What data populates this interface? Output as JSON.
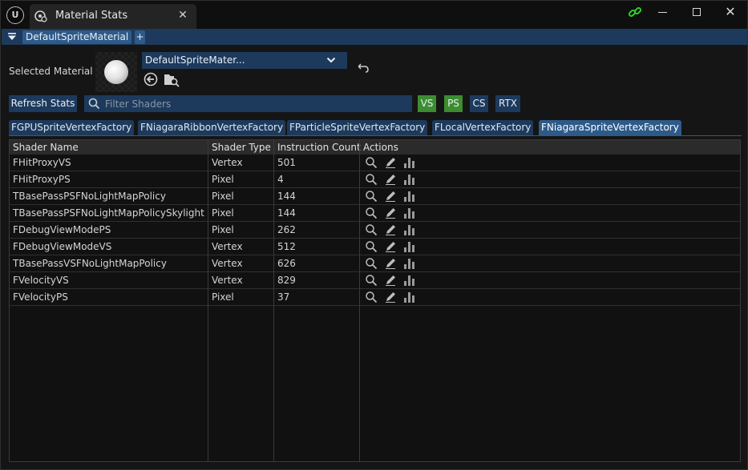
{
  "titlebar": {
    "logo_text": "U",
    "tab_title": "Material Stats",
    "close_glyph": "✕",
    "window_close_glyph": "✕"
  },
  "toolbar": {
    "material_chip": "DefaultSpriteMaterial",
    "add_label": "+"
  },
  "material": {
    "label": "Selected Material",
    "dropdown_value": "DefaultSpriteMater..."
  },
  "filter": {
    "refresh_label": "Refresh Stats",
    "search_placeholder": "Filter Shaders",
    "shader_buttons": [
      "VS",
      "PS",
      "CS",
      "RTX"
    ]
  },
  "vertex_factories": [
    "FGPUSpriteVertexFactory",
    "FNiagaraRibbonVertexFactory",
    "FParticleSpriteVertexFactory",
    "FLocalVertexFactory",
    "FNiagaraSpriteVertexFactory"
  ],
  "active_factory": "FNiagaraSpriteVertexFactory",
  "table": {
    "headers": [
      "Shader Name",
      "Shader Type",
      "Instruction Count",
      "Actions"
    ],
    "rows": [
      {
        "name": "FHitProxyVS",
        "type": "Vertex",
        "count": "501"
      },
      {
        "name": "FHitProxyPS",
        "type": "Pixel",
        "count": "4"
      },
      {
        "name": "TBasePassPSFNoLightMapPolicy",
        "type": "Pixel",
        "count": "144"
      },
      {
        "name": "TBasePassPSFNoLightMapPolicySkylight",
        "type": "Pixel",
        "count": "144"
      },
      {
        "name": "FDebugViewModePS",
        "type": "Pixel",
        "count": "262"
      },
      {
        "name": "FDebugViewModeVS",
        "type": "Vertex",
        "count": "512"
      },
      {
        "name": "TBasePassVSFNoLightMapPolicy",
        "type": "Vertex",
        "count": "626"
      },
      {
        "name": "FVelocityVS",
        "type": "Vertex",
        "count": "829"
      },
      {
        "name": "FVelocityPS",
        "type": "Pixel",
        "count": "37"
      }
    ]
  },
  "colors": {
    "accent_blue": "#1d3a5c",
    "active_blue": "#2e5a89",
    "toggle_green": "#3b8d2f",
    "link_green": "#2fd02f"
  },
  "icons": {
    "row_actions": [
      "search-icon",
      "edit-icon",
      "stats-icon"
    ]
  }
}
